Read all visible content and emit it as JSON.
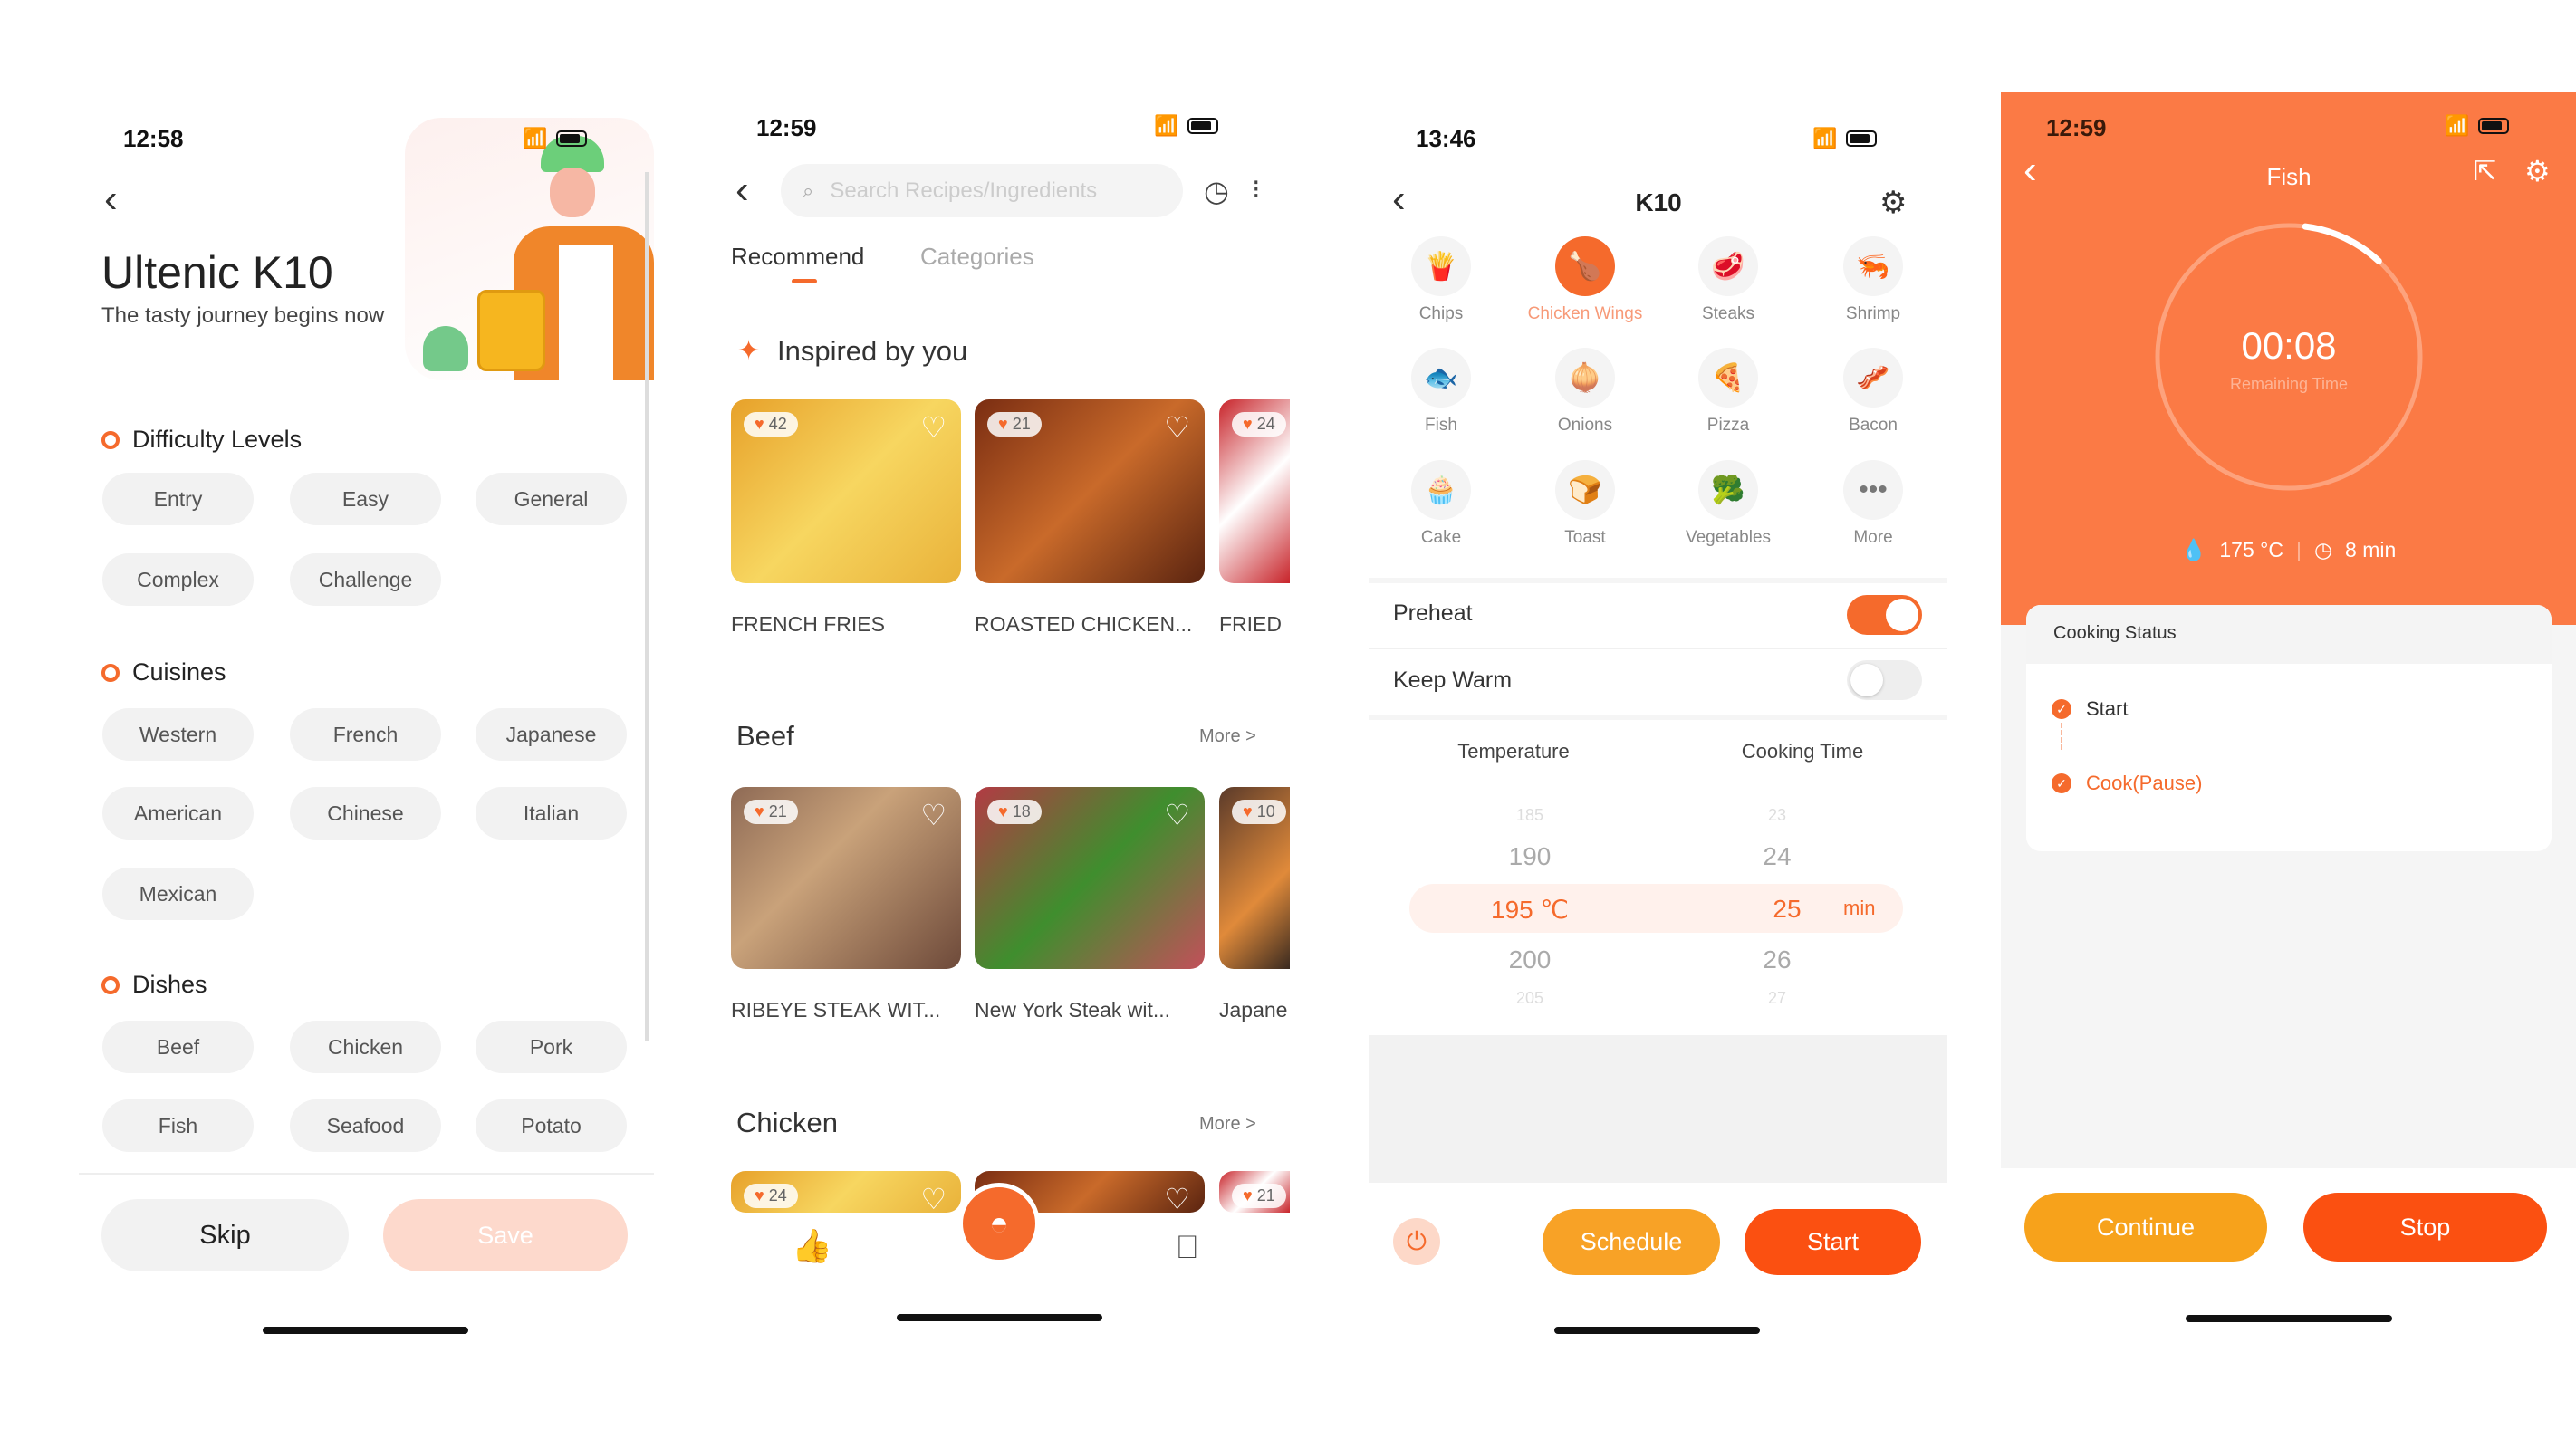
{
  "colors": {
    "accent": "#f56a2c",
    "timer_bg": "#fb7a45",
    "continue": "#f7a21b",
    "stop": "#fb5011",
    "schedule": "#f8a226"
  },
  "screen1": {
    "time": "12:58",
    "title": "Ultenic K10",
    "subtitle": "The tasty journey begins now",
    "sections": [
      {
        "title": "Difficulty Levels",
        "chips": [
          "Entry",
          "Easy",
          "General",
          "Complex",
          "Challenge"
        ]
      },
      {
        "title": "Cuisines",
        "chips": [
          "Western",
          "French",
          "Japanese",
          "American",
          "Chinese",
          "Italian",
          "Mexican"
        ]
      },
      {
        "title": "Dishes",
        "chips": [
          "Beef",
          "Chicken",
          "Pork",
          "Fish",
          "Seafood",
          "Potato"
        ]
      }
    ],
    "skip": "Skip",
    "save": "Save"
  },
  "screen2": {
    "time": "12:59",
    "search_placeholder": "Search Recipes/Ingredients",
    "tabs": [
      "Recommend",
      "Categories"
    ],
    "inspired": "Inspired by you",
    "inspired_cards": [
      {
        "likes": "42",
        "title": "FRENCH FRIES"
      },
      {
        "likes": "21",
        "title": "ROASTED CHICKEN..."
      },
      {
        "likes": "24",
        "title": "FRIED"
      }
    ],
    "beef": "Beef",
    "more": "More >",
    "beef_cards": [
      {
        "likes": "21",
        "title": "RIBEYE STEAK WIT..."
      },
      {
        "likes": "18",
        "title": "New York Steak wit..."
      },
      {
        "likes": "10",
        "title": "Japane"
      }
    ],
    "chicken": "Chicken",
    "chicken_cards": [
      {
        "likes": "24"
      },
      {
        "likes": ""
      },
      {
        "likes": "21"
      }
    ]
  },
  "screen3": {
    "time": "13:46",
    "title": "K10",
    "modes": [
      {
        "label": "Chips",
        "icon": "fries-icon",
        "g": "🍟"
      },
      {
        "label": "Chicken Wings",
        "icon": "chicken-wing-icon",
        "g": "🍗",
        "selected": true
      },
      {
        "label": "Steaks",
        "icon": "steak-icon",
        "g": "🥩"
      },
      {
        "label": "Shrimp",
        "icon": "shrimp-icon",
        "g": "🦐"
      },
      {
        "label": "Fish",
        "icon": "fish-icon",
        "g": "🐟"
      },
      {
        "label": "Onions",
        "icon": "onion-icon",
        "g": "🧅"
      },
      {
        "label": "Pizza",
        "icon": "pizza-icon",
        "g": "🍕"
      },
      {
        "label": "Bacon",
        "icon": "bacon-icon",
        "g": "🥓"
      },
      {
        "label": "Cake",
        "icon": "cake-icon",
        "g": "🧁"
      },
      {
        "label": "Toast",
        "icon": "toast-icon",
        "g": "🍞"
      },
      {
        "label": "Vegetables",
        "icon": "broccoli-icon",
        "g": "🥦"
      },
      {
        "label": "More",
        "icon": "more-icon",
        "g": "•••"
      }
    ],
    "preheat": "Preheat",
    "preheat_on": true,
    "keep_warm": "Keep Warm",
    "keep_warm_on": false,
    "temp_header": "Temperature",
    "time_header": "Cooking Time",
    "temps": [
      "185",
      "190",
      "195 ℃",
      "200",
      "205"
    ],
    "minutes": [
      "23",
      "24",
      "25",
      "26",
      "27"
    ],
    "min_unit": "min",
    "schedule": "Schedule",
    "start": "Start"
  },
  "screen4": {
    "time": "12:59",
    "title": "Fish",
    "remaining": "00:08",
    "remaining_label": "Remaining Time",
    "progress": 0.1,
    "temp": "175 °C",
    "duration": "8 min",
    "status_title": "Cooking Status",
    "steps": [
      "Start",
      "Cook(Pause)"
    ],
    "continue": "Continue",
    "stop": "Stop"
  }
}
